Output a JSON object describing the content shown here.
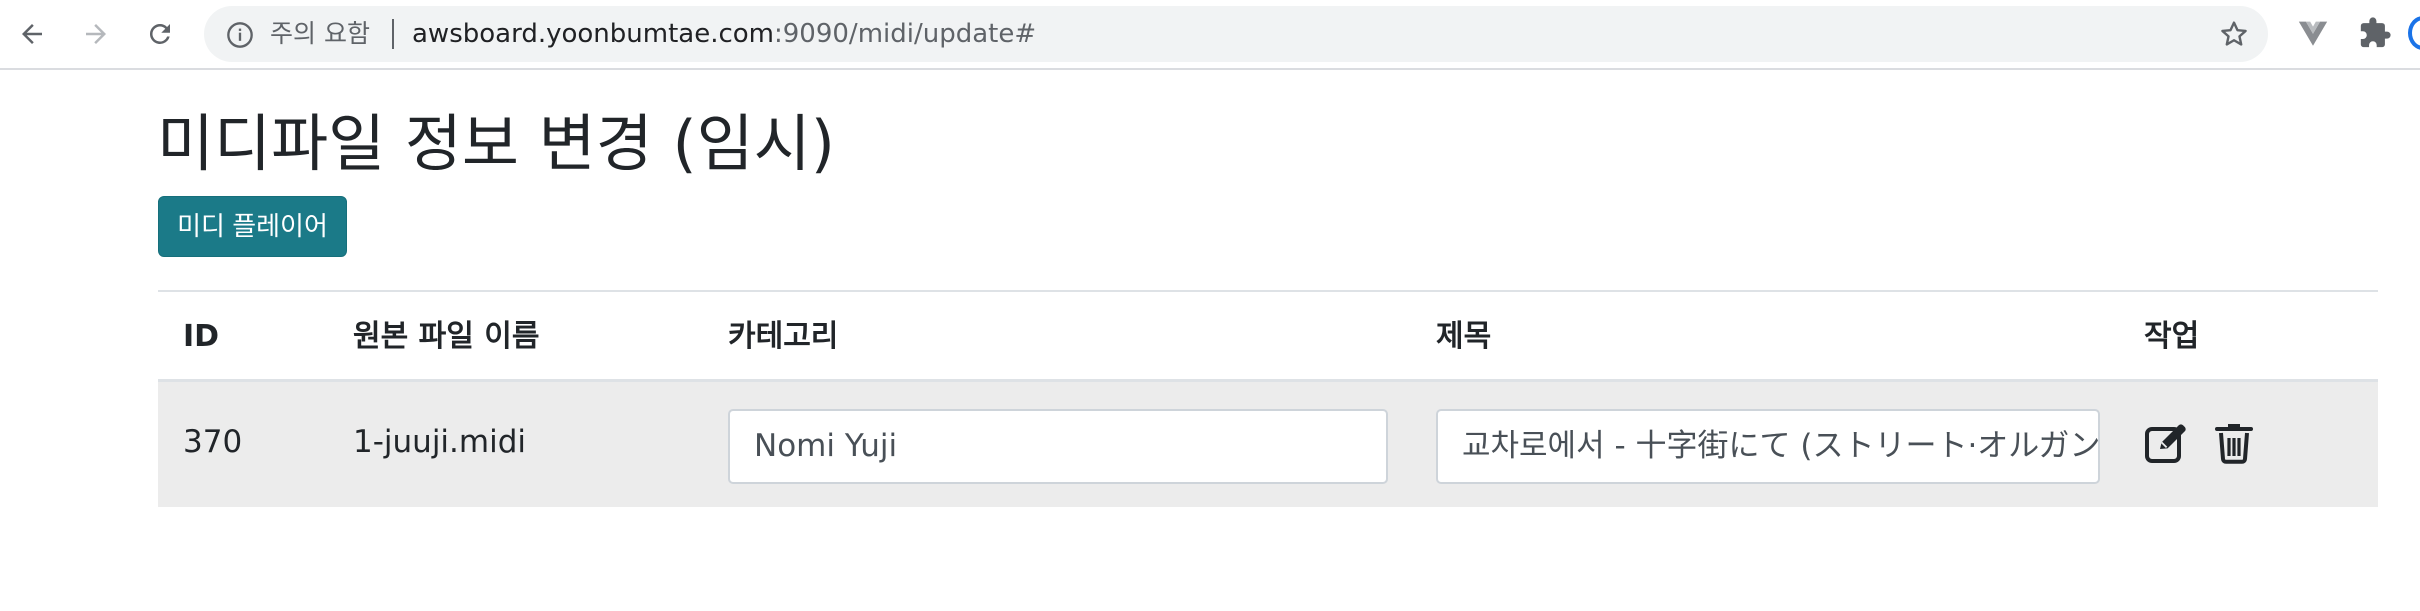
{
  "browser": {
    "security_label": "주의 요함",
    "url_host": "awsboard.yoonbumtae.com",
    "url_rest": ":9090/midi/update#",
    "icons": [
      "back-arrow-icon",
      "forward-arrow-icon",
      "reload-icon",
      "info-icon",
      "star-icon",
      "vue-devtools-icon",
      "extensions-puzzle-icon"
    ]
  },
  "page": {
    "title": "미디파일 정보 변경 (임시)",
    "player_button_label": "미디 플레이어",
    "accent_color": "#1b7a88"
  },
  "table": {
    "headers": {
      "id": "ID",
      "filename": "원본 파일 이름",
      "category": "카테고리",
      "title": "제목",
      "actions": "작업"
    },
    "rows": [
      {
        "id": "370",
        "filename": "1-juuji.midi",
        "category": "Nomi Yuji",
        "title": "교차로에서  - 十字街にて (ストリート·オルガン)",
        "action_icons": [
          "edit-icon",
          "trash-icon"
        ]
      }
    ]
  }
}
